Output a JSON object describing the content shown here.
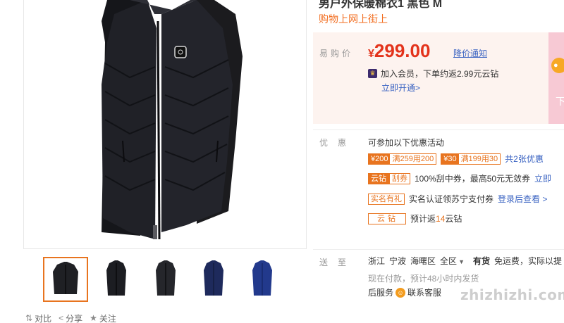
{
  "product": {
    "title": "男户外保暖棉衣1 黑色 M",
    "subtitle": "购物上网上街上"
  },
  "price": {
    "label": "易购价",
    "currency": "¥",
    "value": "299.00",
    "notify_label": "降价通知",
    "member_text": "加入会员，下单约返2.99元云钻",
    "member_link": "立即开通>"
  },
  "promotions": {
    "label": "优惠",
    "intro": "可参加以下优惠活动",
    "coupons": [
      {
        "amount": "¥200",
        "condition": "满259用200"
      },
      {
        "amount": "¥30",
        "condition": "满199用30"
      }
    ],
    "coupons_more": "共2张优惠",
    "lottery": {
      "tag1": "云钻",
      "tag2": "刮券",
      "text": "100%刮中券，最高50元无敛券",
      "link": "立即"
    },
    "realname": {
      "tag": "实名有礼",
      "text": "实名认证领苏宁支付券",
      "link": "登录后查看 >"
    },
    "cloud": {
      "tag": "云钻",
      "text_prefix": "预计返",
      "amount": "14",
      "text_suffix": "云钻"
    }
  },
  "delivery": {
    "label": "送至",
    "province": "浙江",
    "city": "宁波",
    "district": "海曙区",
    "area": "全区",
    "stock": "有货",
    "shipping": "免运费，实际以提",
    "note": "现在付款，预计48小时内发货",
    "service_prefix": "后服务",
    "service_link": "联系客服"
  },
  "gallery": {
    "thumbnails": [
      {
        "color": "#1f2024"
      },
      {
        "color": "#1c1d22"
      },
      {
        "color": "#25262b"
      },
      {
        "color": "#1e2a5c"
      },
      {
        "color": "#22398c"
      }
    ],
    "active_index": 0
  },
  "actions": {
    "compare": "对比",
    "share": "分享",
    "follow": "关注"
  },
  "banner": {
    "text": "下"
  },
  "watermark": "zhizhizhi.com",
  "colors": {
    "accent": "#e8741f",
    "price": "#e3331b",
    "link": "#3a63c2",
    "price_bg": "#fdf3ef"
  }
}
